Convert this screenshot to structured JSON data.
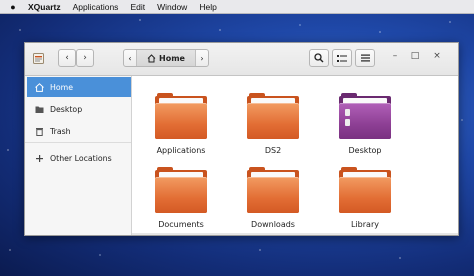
{
  "menubar": {
    "app_name": "XQuartz",
    "items": [
      "Applications",
      "Edit",
      "Window",
      "Help"
    ]
  },
  "toolbar": {
    "back_label": "‹",
    "forward_label": "›",
    "path_left_label": "‹",
    "path_home_label": "Home",
    "path_right_label": "›",
    "search_icon": "search-icon",
    "view_icon": "list-view-icon",
    "menu_icon": "hamburger-menu-icon",
    "minimize_label": "–",
    "maximize_label": "□",
    "close_label": "×"
  },
  "sidebar": {
    "items": [
      {
        "label": "Home",
        "icon": "home-icon",
        "active": true
      },
      {
        "label": "Desktop",
        "icon": "folder-icon",
        "active": false
      },
      {
        "label": "Trash",
        "icon": "trash-icon",
        "active": false
      },
      {
        "label": "Other Locations",
        "icon": "plus-icon",
        "active": false
      }
    ]
  },
  "files": [
    {
      "name": "Applications",
      "kind": "folder"
    },
    {
      "name": "DS2",
      "kind": "folder"
    },
    {
      "name": "Desktop",
      "kind": "desktop-folder"
    },
    {
      "name": "Documents",
      "kind": "folder"
    },
    {
      "name": "Downloads",
      "kind": "folder"
    },
    {
      "name": "Library",
      "kind": "folder"
    }
  ],
  "colors": {
    "accent": "#4a90d9",
    "folder_orange": "#e26d34",
    "desktop_purple": "#8d3f94"
  }
}
